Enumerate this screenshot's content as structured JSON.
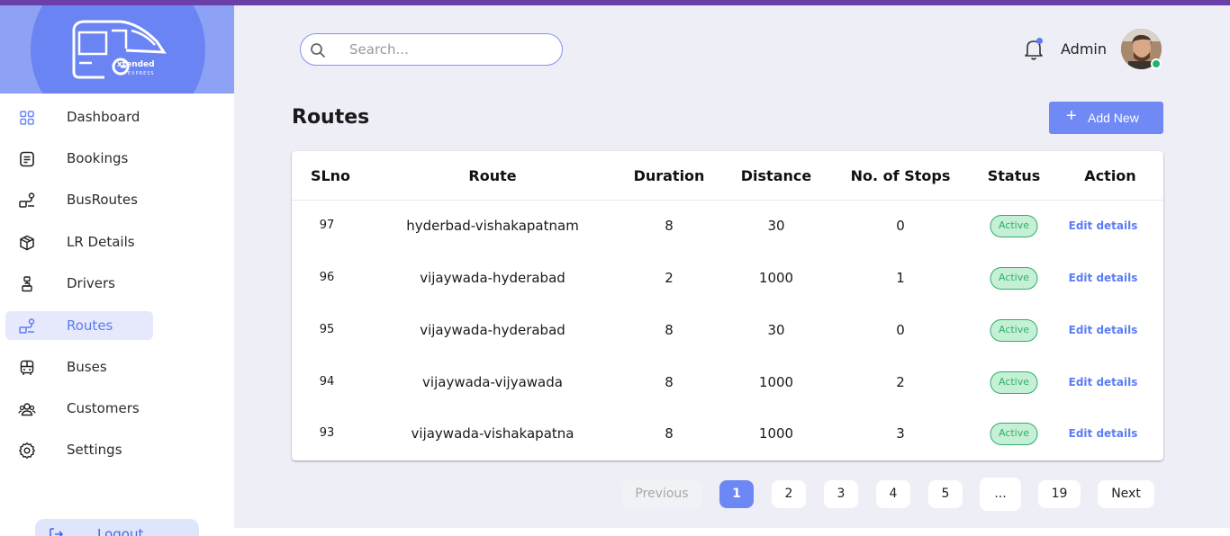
{
  "brand": {
    "logo_text": "xtended",
    "logo_sub": "EXPRESS"
  },
  "search": {
    "placeholder": "Search..."
  },
  "header": {
    "admin_name": "Admin"
  },
  "sidebar": {
    "items": [
      {
        "label": "Dashboard",
        "icon": "grid-icon"
      },
      {
        "label": "Bookings",
        "icon": "document-icon"
      },
      {
        "label": "BusRoutes",
        "icon": "route-icon"
      },
      {
        "label": "LR Details",
        "icon": "package-icon"
      },
      {
        "label": "Drivers",
        "icon": "driver-icon"
      },
      {
        "label": "Routes",
        "icon": "route-icon",
        "active": true
      },
      {
        "label": "Buses",
        "icon": "bus-icon"
      },
      {
        "label": "Customers",
        "icon": "users-icon"
      },
      {
        "label": "Settings",
        "icon": "gear-icon"
      }
    ],
    "logout_label": "Logout"
  },
  "page": {
    "title": "Routes",
    "add_button": "Add New",
    "add_icon": "+"
  },
  "table": {
    "headers": [
      "SLno",
      "Route",
      "Duration",
      "Distance",
      "No. of Stops",
      "Status",
      "Action"
    ],
    "rows": [
      {
        "slno": "97",
        "route": "hyderbad-vishakapatnam",
        "duration": "8",
        "distance": "30",
        "stops": "0",
        "status": "Active",
        "action": "Edit details"
      },
      {
        "slno": "96",
        "route": "vijaywada-hyderabad",
        "duration": "2",
        "distance": "1000",
        "stops": "1",
        "status": "Active",
        "action": "Edit details"
      },
      {
        "slno": "95",
        "route": "vijaywada-hyderabad",
        "duration": "8",
        "distance": "30",
        "stops": "0",
        "status": "Active",
        "action": "Edit details"
      },
      {
        "slno": "94",
        "route": "vijaywada-vijyawada",
        "duration": "8",
        "distance": "1000",
        "stops": "2",
        "status": "Active",
        "action": "Edit details"
      },
      {
        "slno": "93",
        "route": "vijaywada-vishakapatna",
        "duration": "8",
        "distance": "1000",
        "stops": "3",
        "status": "Active",
        "action": "Edit details"
      }
    ]
  },
  "pagination": {
    "previous": "Previous",
    "pages": [
      "1",
      "2",
      "3",
      "4",
      "5",
      "...",
      "19"
    ],
    "current": "1",
    "next": "Next"
  },
  "colors": {
    "accent": "#6d87f4",
    "active_green": "#2fae6b",
    "top_bar": "#6b3fa8"
  }
}
